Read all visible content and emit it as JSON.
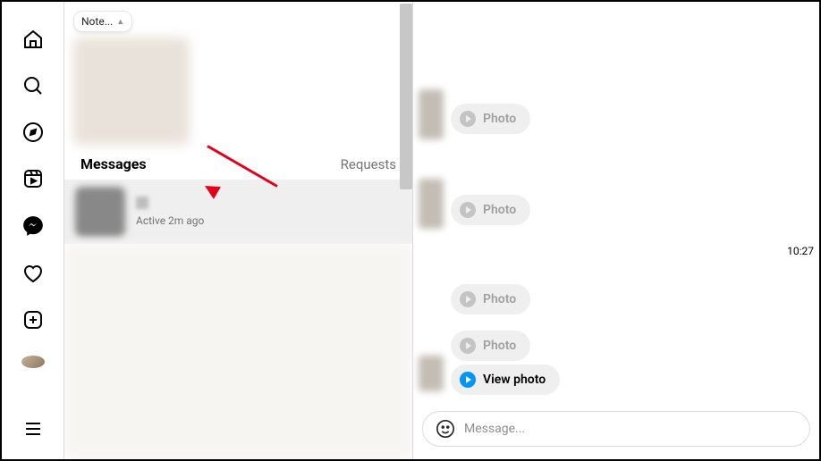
{
  "note": {
    "label": "Note..."
  },
  "section": {
    "title": "Messages",
    "requests": "Requests"
  },
  "conversation": {
    "status": "Active 2m ago"
  },
  "messages": {
    "photo_label": "Photo",
    "view_label": "View photo"
  },
  "timestamp": "10:27",
  "composer": {
    "placeholder": "Message..."
  }
}
